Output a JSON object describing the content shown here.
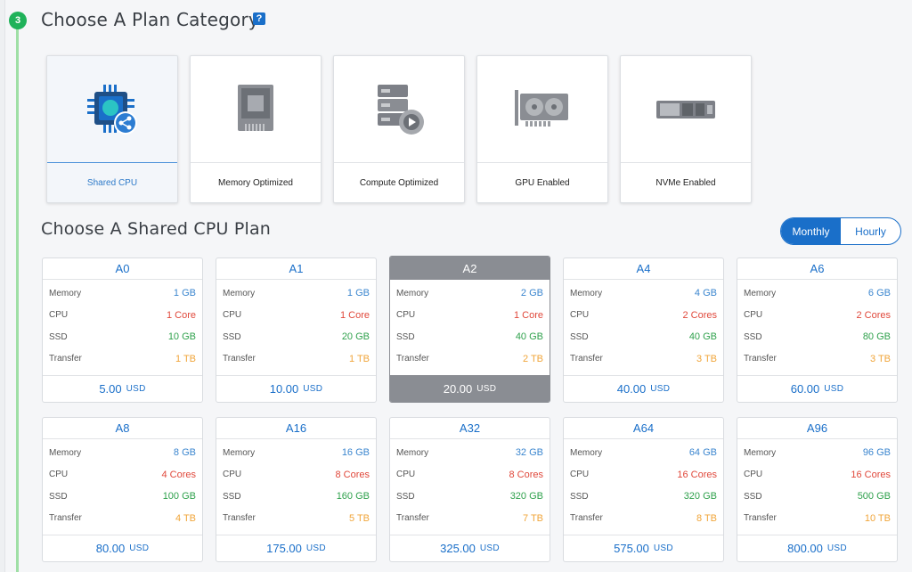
{
  "step": {
    "number": "3"
  },
  "category_section": {
    "title": "Choose A Plan Category",
    "help_icon": "?"
  },
  "categories": [
    {
      "label": "Shared CPU",
      "icon": "shared-cpu-icon",
      "selected": true
    },
    {
      "label": "Memory Optimized",
      "icon": "memory-chip-icon",
      "selected": false
    },
    {
      "label": "Compute Optimized",
      "icon": "server-gear-icon",
      "selected": false
    },
    {
      "label": "GPU Enabled",
      "icon": "gpu-card-icon",
      "selected": false
    },
    {
      "label": "NVMe Enabled",
      "icon": "nvme-drive-icon",
      "selected": false
    }
  ],
  "plan_section": {
    "title": "Choose A Shared CPU Plan"
  },
  "billing_toggle": {
    "monthly": "Monthly",
    "hourly": "Hourly",
    "active": "monthly"
  },
  "spec_labels": {
    "memory": "Memory",
    "cpu": "CPU",
    "ssd": "SSD",
    "transfer": "Transfer"
  },
  "currency": "USD",
  "plans": [
    {
      "name": "A0",
      "memory": "1 GB",
      "cpu": "1 Core",
      "ssd": "10 GB",
      "transfer": "1 TB",
      "price": "5.00"
    },
    {
      "name": "A1",
      "memory": "1 GB",
      "cpu": "1 Core",
      "ssd": "20 GB",
      "transfer": "1 TB",
      "price": "10.00"
    },
    {
      "name": "A2",
      "memory": "2 GB",
      "cpu": "1 Core",
      "ssd": "40 GB",
      "transfer": "2 TB",
      "price": "20.00",
      "selected": true
    },
    {
      "name": "A4",
      "memory": "4 GB",
      "cpu": "2 Cores",
      "ssd": "40 GB",
      "transfer": "3 TB",
      "price": "40.00"
    },
    {
      "name": "A6",
      "memory": "6 GB",
      "cpu": "2 Cores",
      "ssd": "80 GB",
      "transfer": "3 TB",
      "price": "60.00"
    },
    {
      "name": "A8",
      "memory": "8 GB",
      "cpu": "4 Cores",
      "ssd": "100 GB",
      "transfer": "4 TB",
      "price": "80.00"
    },
    {
      "name": "A16",
      "memory": "16 GB",
      "cpu": "8 Cores",
      "ssd": "160 GB",
      "transfer": "5 TB",
      "price": "175.00"
    },
    {
      "name": "A32",
      "memory": "32 GB",
      "cpu": "8 Cores",
      "ssd": "320 GB",
      "transfer": "7 TB",
      "price": "325.00"
    },
    {
      "name": "A64",
      "memory": "64 GB",
      "cpu": "16 Cores",
      "ssd": "320 GB",
      "transfer": "8 TB",
      "price": "575.00"
    },
    {
      "name": "A96",
      "memory": "96 GB",
      "cpu": "16 Cores",
      "ssd": "500 GB",
      "transfer": "10 TB",
      "price": "800.00"
    }
  ]
}
